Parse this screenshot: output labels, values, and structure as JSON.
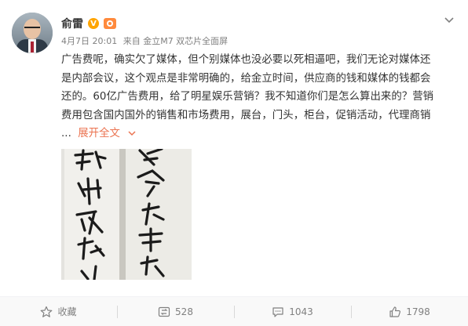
{
  "user": {
    "name": "俞雷",
    "verified_badge": "V",
    "level_badge": "iconic",
    "avatar_icon": "user-avatar"
  },
  "post": {
    "date": "4月7日 20:01",
    "source": "来自 金立M7 双芯片全面屏",
    "text_lines": [
      "广告费呢，确实欠了媒体，但个别媒体也没必要以死相逼吧，我们无论对媒体还",
      "是内部会议，这个观点是非常明确的，给金立时间，供应商的钱和媒体的钱都会",
      "还的。60亿广告费用，给了明星娱乐营销？我不知道你们是怎么算出来的？营销",
      "费用包含国内国外的销售和市场费用，展台，门头，柜台，促销活动，代理商销"
    ],
    "ellipsis": "...",
    "expand_label": "展开全文",
    "expand_icon": "chevron-down-icon",
    "image_alt": "handwritten calligraphy"
  },
  "actions": {
    "favorite_label": "收藏",
    "repost_count": "528",
    "comment_count": "1043",
    "like_count": "1798"
  },
  "colors": {
    "link": "#eb7350",
    "muted": "#808080",
    "badge_v": "#ffa500"
  }
}
